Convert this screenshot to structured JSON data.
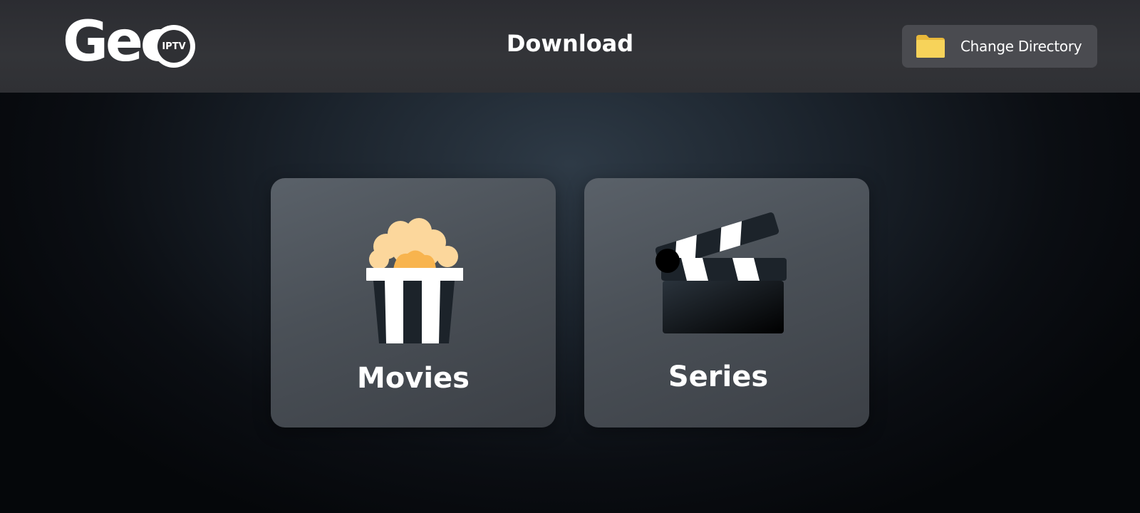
{
  "header": {
    "logo_text": "Geo",
    "logo_badge": "IPTV",
    "title": "Download",
    "change_directory_label": "Change Directory",
    "change_directory_icon": "folder-icon"
  },
  "categories": [
    {
      "label": "Movies",
      "icon": "popcorn-icon"
    },
    {
      "label": "Series",
      "icon": "clapperboard-icon"
    }
  ],
  "colors": {
    "folder": "#f7d35a",
    "popcorn": "#fcd79c",
    "popcorn_accent": "#f8b44e"
  }
}
